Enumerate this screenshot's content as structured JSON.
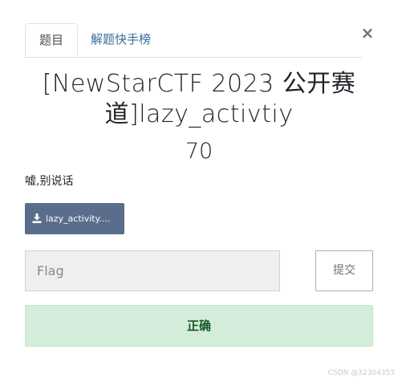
{
  "tabs": [
    {
      "label": "题目"
    },
    {
      "label": "解题快手榜"
    }
  ],
  "close_symbol": "×",
  "challenge": {
    "title": "[NewStarCTF 2023 公开赛道]lazy_activtiy",
    "points": "70",
    "description": "嘘,别说话",
    "file_label": "lazy_activity...."
  },
  "flag": {
    "placeholder": "Flag",
    "value": ""
  },
  "submit_label": "提交",
  "result_text": "正确",
  "watermark": "CSDN @32304353",
  "colors": {
    "file_button": "#5b6d8c",
    "success_bg": "#d4eddb",
    "success_text": "#155724",
    "tab_link": "#3d6b9c"
  },
  "icons": {
    "download": "download-icon",
    "close": "close-icon"
  }
}
